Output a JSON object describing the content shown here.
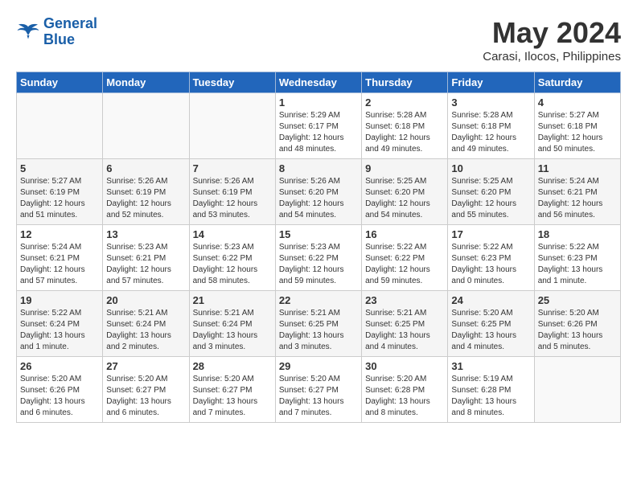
{
  "logo": {
    "line1": "General",
    "line2": "Blue"
  },
  "title": "May 2024",
  "location": "Carasi, Ilocos, Philippines",
  "weekdays": [
    "Sunday",
    "Monday",
    "Tuesday",
    "Wednesday",
    "Thursday",
    "Friday",
    "Saturday"
  ],
  "weeks": [
    [
      {
        "day": "",
        "detail": ""
      },
      {
        "day": "",
        "detail": ""
      },
      {
        "day": "",
        "detail": ""
      },
      {
        "day": "1",
        "detail": "Sunrise: 5:29 AM\nSunset: 6:17 PM\nDaylight: 12 hours\nand 48 minutes."
      },
      {
        "day": "2",
        "detail": "Sunrise: 5:28 AM\nSunset: 6:18 PM\nDaylight: 12 hours\nand 49 minutes."
      },
      {
        "day": "3",
        "detail": "Sunrise: 5:28 AM\nSunset: 6:18 PM\nDaylight: 12 hours\nand 49 minutes."
      },
      {
        "day": "4",
        "detail": "Sunrise: 5:27 AM\nSunset: 6:18 PM\nDaylight: 12 hours\nand 50 minutes."
      }
    ],
    [
      {
        "day": "5",
        "detail": "Sunrise: 5:27 AM\nSunset: 6:19 PM\nDaylight: 12 hours\nand 51 minutes."
      },
      {
        "day": "6",
        "detail": "Sunrise: 5:26 AM\nSunset: 6:19 PM\nDaylight: 12 hours\nand 52 minutes."
      },
      {
        "day": "7",
        "detail": "Sunrise: 5:26 AM\nSunset: 6:19 PM\nDaylight: 12 hours\nand 53 minutes."
      },
      {
        "day": "8",
        "detail": "Sunrise: 5:26 AM\nSunset: 6:20 PM\nDaylight: 12 hours\nand 54 minutes."
      },
      {
        "day": "9",
        "detail": "Sunrise: 5:25 AM\nSunset: 6:20 PM\nDaylight: 12 hours\nand 54 minutes."
      },
      {
        "day": "10",
        "detail": "Sunrise: 5:25 AM\nSunset: 6:20 PM\nDaylight: 12 hours\nand 55 minutes."
      },
      {
        "day": "11",
        "detail": "Sunrise: 5:24 AM\nSunset: 6:21 PM\nDaylight: 12 hours\nand 56 minutes."
      }
    ],
    [
      {
        "day": "12",
        "detail": "Sunrise: 5:24 AM\nSunset: 6:21 PM\nDaylight: 12 hours\nand 57 minutes."
      },
      {
        "day": "13",
        "detail": "Sunrise: 5:23 AM\nSunset: 6:21 PM\nDaylight: 12 hours\nand 57 minutes."
      },
      {
        "day": "14",
        "detail": "Sunrise: 5:23 AM\nSunset: 6:22 PM\nDaylight: 12 hours\nand 58 minutes."
      },
      {
        "day": "15",
        "detail": "Sunrise: 5:23 AM\nSunset: 6:22 PM\nDaylight: 12 hours\nand 59 minutes."
      },
      {
        "day": "16",
        "detail": "Sunrise: 5:22 AM\nSunset: 6:22 PM\nDaylight: 12 hours\nand 59 minutes."
      },
      {
        "day": "17",
        "detail": "Sunrise: 5:22 AM\nSunset: 6:23 PM\nDaylight: 13 hours\nand 0 minutes."
      },
      {
        "day": "18",
        "detail": "Sunrise: 5:22 AM\nSunset: 6:23 PM\nDaylight: 13 hours\nand 1 minute."
      }
    ],
    [
      {
        "day": "19",
        "detail": "Sunrise: 5:22 AM\nSunset: 6:24 PM\nDaylight: 13 hours\nand 1 minute."
      },
      {
        "day": "20",
        "detail": "Sunrise: 5:21 AM\nSunset: 6:24 PM\nDaylight: 13 hours\nand 2 minutes."
      },
      {
        "day": "21",
        "detail": "Sunrise: 5:21 AM\nSunset: 6:24 PM\nDaylight: 13 hours\nand 3 minutes."
      },
      {
        "day": "22",
        "detail": "Sunrise: 5:21 AM\nSunset: 6:25 PM\nDaylight: 13 hours\nand 3 minutes."
      },
      {
        "day": "23",
        "detail": "Sunrise: 5:21 AM\nSunset: 6:25 PM\nDaylight: 13 hours\nand 4 minutes."
      },
      {
        "day": "24",
        "detail": "Sunrise: 5:20 AM\nSunset: 6:25 PM\nDaylight: 13 hours\nand 4 minutes."
      },
      {
        "day": "25",
        "detail": "Sunrise: 5:20 AM\nSunset: 6:26 PM\nDaylight: 13 hours\nand 5 minutes."
      }
    ],
    [
      {
        "day": "26",
        "detail": "Sunrise: 5:20 AM\nSunset: 6:26 PM\nDaylight: 13 hours\nand 6 minutes."
      },
      {
        "day": "27",
        "detail": "Sunrise: 5:20 AM\nSunset: 6:27 PM\nDaylight: 13 hours\nand 6 minutes."
      },
      {
        "day": "28",
        "detail": "Sunrise: 5:20 AM\nSunset: 6:27 PM\nDaylight: 13 hours\nand 7 minutes."
      },
      {
        "day": "29",
        "detail": "Sunrise: 5:20 AM\nSunset: 6:27 PM\nDaylight: 13 hours\nand 7 minutes."
      },
      {
        "day": "30",
        "detail": "Sunrise: 5:20 AM\nSunset: 6:28 PM\nDaylight: 13 hours\nand 8 minutes."
      },
      {
        "day": "31",
        "detail": "Sunrise: 5:19 AM\nSunset: 6:28 PM\nDaylight: 13 hours\nand 8 minutes."
      },
      {
        "day": "",
        "detail": ""
      }
    ]
  ]
}
